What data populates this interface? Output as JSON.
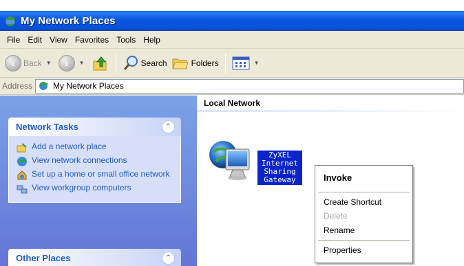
{
  "window": {
    "title": "My Network Places"
  },
  "menubar": {
    "items": [
      "File",
      "Edit",
      "View",
      "Favorites",
      "Tools",
      "Help"
    ]
  },
  "toolbar": {
    "back_label": "Back",
    "search_label": "Search",
    "folders_label": "Folders"
  },
  "address": {
    "label": "Address",
    "value": "My Network Places"
  },
  "network_tasks": {
    "title": "Network Tasks",
    "items": [
      "Add a network place",
      "View network connections",
      "Set up a home or small office network",
      "View workgroup computers"
    ]
  },
  "other_places": {
    "title": "Other Places"
  },
  "content": {
    "group_title": "Local Network",
    "device_label": "ZyXEL Internet Sharing Gateway",
    "device_label_lines": [
      "ZyXEL",
      "Internet",
      "Sharing",
      "Gateway"
    ]
  },
  "context_menu": {
    "items": [
      "Invoke",
      "Create Shortcut",
      "Delete",
      "Rename",
      "Properties"
    ]
  },
  "colors": {
    "titlebar": "#0b58df",
    "task_link": "#215dc6",
    "selection": "#0a24c9",
    "left_pane": "#7ba2e7"
  }
}
